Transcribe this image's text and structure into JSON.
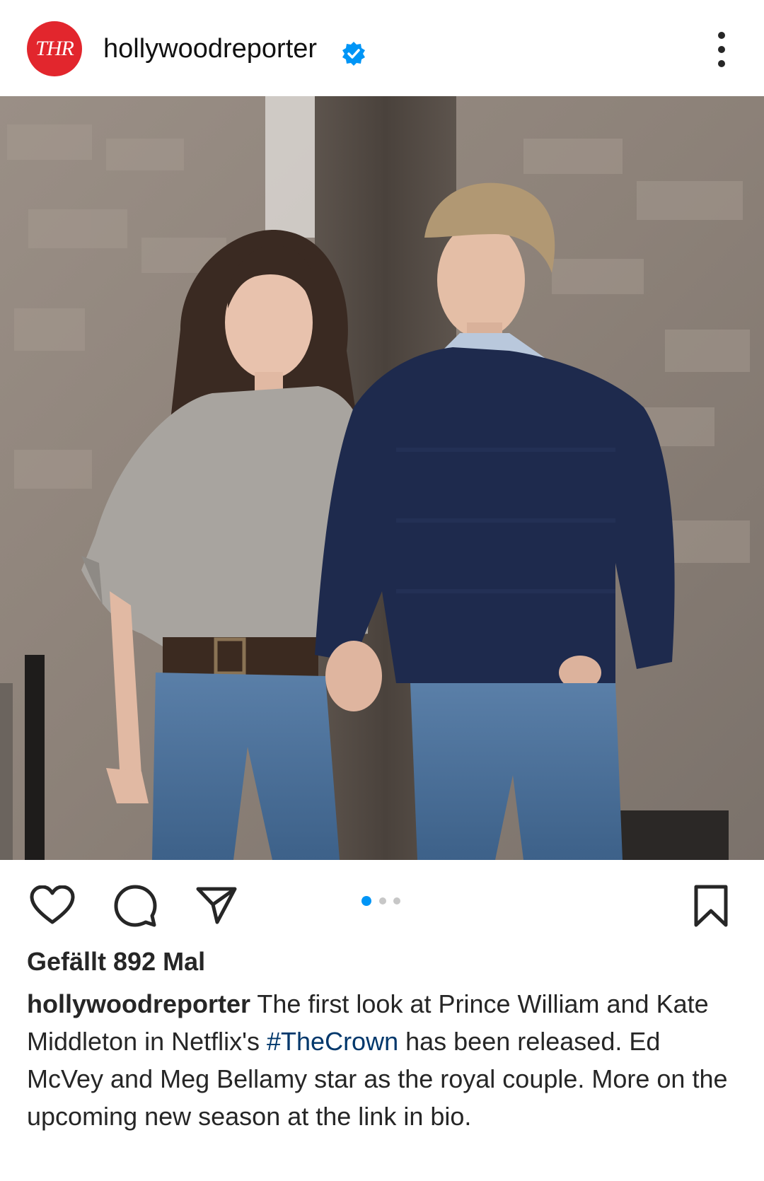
{
  "header": {
    "avatar_text": "THR",
    "username": "hollywoodreporter",
    "verified": true
  },
  "post": {
    "image_alt": "Photo of a young couple holding hands walking in front of a stone wall",
    "carousel": {
      "count": 3,
      "active_index": 0
    }
  },
  "actions": {
    "like_icon": "heart-icon",
    "comment_icon": "comment-icon",
    "share_icon": "send-icon",
    "save_icon": "bookmark-icon"
  },
  "likes_text": "Gefällt 892 Mal",
  "caption": {
    "username": "hollywoodreporter",
    "text_before_tag": " The first look at Prince William and Kate Middleton in Netflix's ",
    "hashtag": "#TheCrown",
    "text_after_tag": " has been released.  Ed McVey and Meg Bellamy star as the royal couple. More on the upcoming new season at the link in bio."
  },
  "colors": {
    "brand_red": "#e2262d",
    "verified_blue": "#0095f6",
    "hashtag": "#00376b",
    "dot_active": "#0095f6",
    "dot_inactive": "#c7c7c7"
  }
}
